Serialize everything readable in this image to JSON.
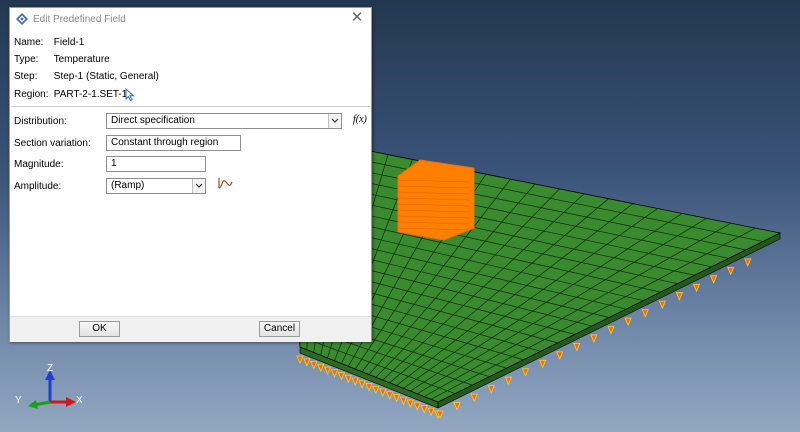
{
  "dialog": {
    "title": "Edit Predefined Field",
    "close_glyph": "✕",
    "info": [
      {
        "label": "Name:",
        "value": "Field-1"
      },
      {
        "label": "Type:",
        "value": "Temperature"
      },
      {
        "label": "Step:",
        "value": "Step-1 (Static, General)"
      },
      {
        "label": "Region:",
        "value": "PART-2-1.SET-1"
      }
    ],
    "distribution": {
      "label": "Distribution:",
      "value": "Direct specification",
      "fx": "f(x)"
    },
    "section_variation": {
      "label": "Section variation:",
      "value": "Constant through region"
    },
    "magnitude": {
      "label": "Magnitude:",
      "value": "1"
    },
    "amplitude": {
      "label": "Amplitude:",
      "value": "(Ramp)"
    },
    "ok_label": "OK",
    "cancel_label": "Cancel"
  },
  "triad": {
    "z": "Z",
    "y": "Y",
    "x": "X"
  },
  "colors": {
    "mesh_green": "#3a8a2f",
    "set_orange": "#ff8000",
    "bc_orange": "#ff6a00",
    "triad_z": "#1f3fd0",
    "triad_y": "#18a018",
    "triad_x": "#d01818"
  },
  "icons": {
    "title": "abaqus-logo-icon",
    "region_edit": "arrow-cursor-icon",
    "amplitude": "amplitude-curve-icon"
  }
}
